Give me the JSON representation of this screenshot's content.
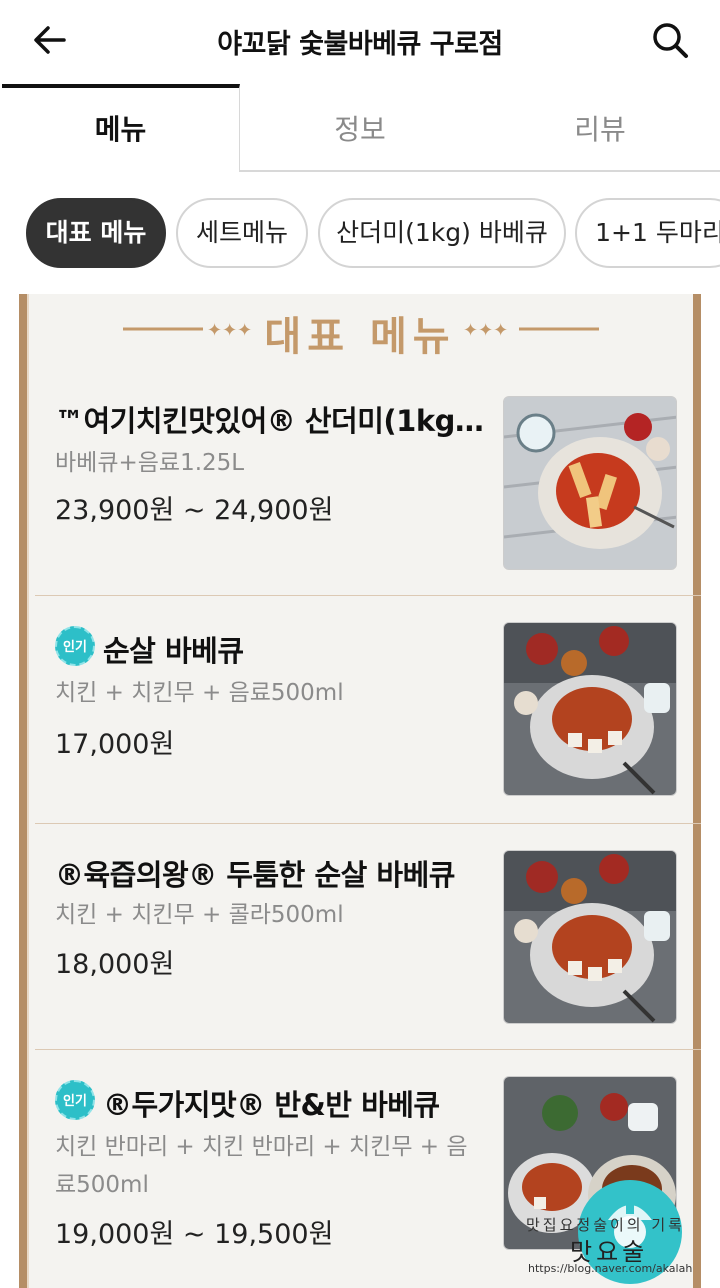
{
  "header": {
    "title": "야꼬닭 숯불바베큐 구로점",
    "back_icon": "back-arrow-icon",
    "search_icon": "search-icon"
  },
  "tabs": [
    {
      "label": "메뉴",
      "active": true
    },
    {
      "label": "정보",
      "active": false
    },
    {
      "label": "리뷰",
      "active": false
    }
  ],
  "chips": [
    {
      "label": "대표 메뉴",
      "active": true
    },
    {
      "label": "세트메뉴",
      "active": false
    },
    {
      "label": "산더미(1kg) 바베큐",
      "active": false
    },
    {
      "label": "1+1 두마리",
      "active": false
    }
  ],
  "section": {
    "title": "대표 메뉴",
    "accent_color": "#c4996a",
    "frame_color": "#b58e66"
  },
  "badge_color": "#2dbfc8",
  "items": [
    {
      "name": "™여기치킨맛있어® 산더미(1kg…",
      "desc": "바베큐+음료1.25L",
      "price": "23,900원 ~ 24,900원",
      "badge": ""
    },
    {
      "name": "순살 바베큐",
      "desc": "치킨 + 치킨무 + 음료500ml",
      "price": "17,000원",
      "badge": "인기"
    },
    {
      "name": "®육즙의왕® 두툼한 순살 바베큐",
      "desc": "치킨 + 치킨무 + 콜라500ml",
      "price": "18,000원",
      "badge": ""
    },
    {
      "name": "®두가지맛® 반&반 바베큐",
      "desc": "치킨 반마리 + 치킨 반마리 + 치킨무 + 음료500ml",
      "price": "19,000원 ~ 19,500원",
      "badge": "인기"
    }
  ],
  "watermark": {
    "line1": "맛집요정술이의 기록",
    "line2": "맛요술",
    "url": "https://blog.naver.com/akalah"
  }
}
